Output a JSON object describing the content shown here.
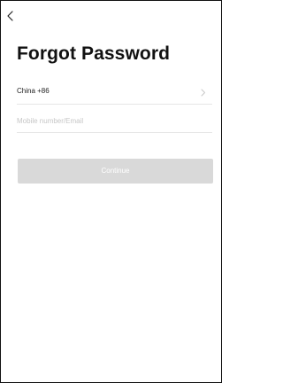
{
  "header": {
    "back_icon": "chevron-left-icon"
  },
  "page": {
    "title": "Forgot Password"
  },
  "form": {
    "country_code_label": "China +86",
    "country_chevron_icon": "chevron-right-icon",
    "account_placeholder": "Mobile number/Email",
    "account_value": "",
    "continue_label": "Continue"
  },
  "colors": {
    "text_primary": "#111111",
    "placeholder": "#c6c6c6",
    "divider": "#e6e6e6",
    "button_disabled_bg": "#d9d9d9",
    "button_text": "#ffffff"
  }
}
